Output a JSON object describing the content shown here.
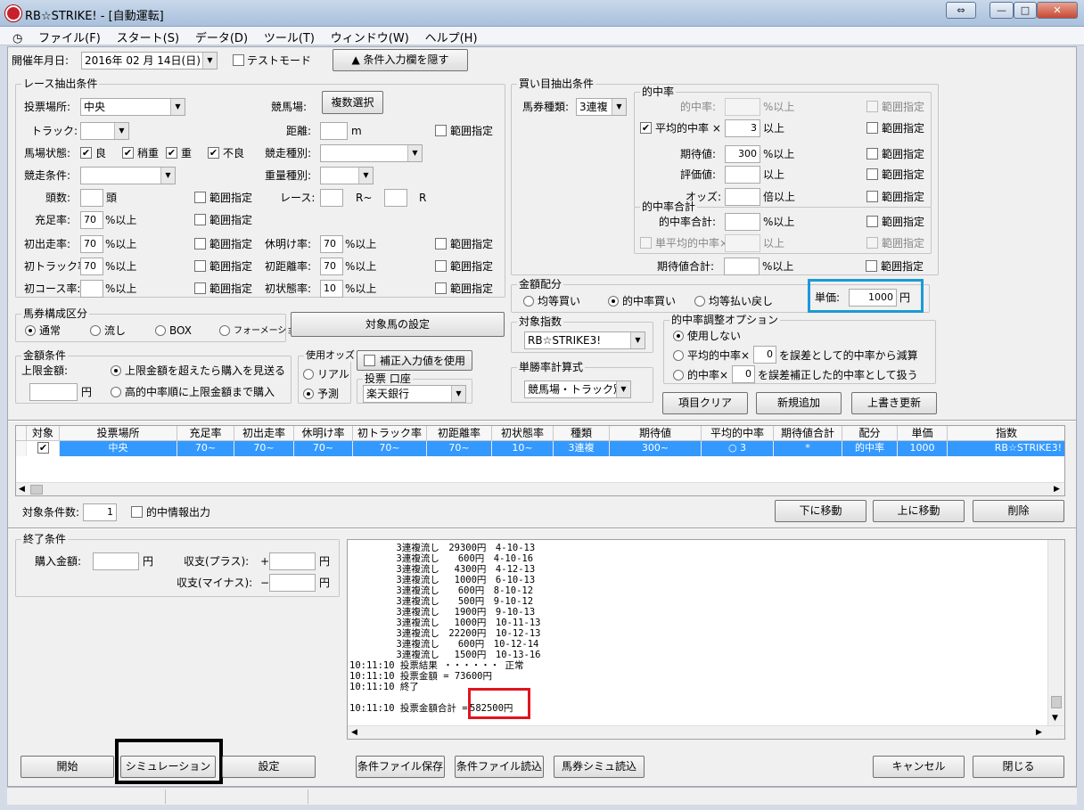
{
  "window": {
    "title": "RB☆STRIKE! - [自動運転]",
    "btn_restore": "⇔",
    "btn_min": "—",
    "btn_max": "□",
    "btn_close": "✕"
  },
  "menu": [
    "ファイル(F)",
    "スタート(S)",
    "データ(D)",
    "ツール(T)",
    "ウィンドウ(W)",
    "ヘルプ(H)"
  ],
  "mdi": [
    "_",
    "▭",
    "✕"
  ],
  "top": {
    "date_label": "開催年月日:",
    "date_value": "2016年 02 月 14日(日)",
    "test_mode": "テストモード",
    "hide_btn": "▲ 条件入力欄を隠す"
  },
  "race": {
    "legend": "レース抽出条件",
    "venue_label": "投票場所:",
    "venue_value": "中央",
    "course_label": "競馬場:",
    "multi_btn": "複数選択",
    "track_label": "トラック:",
    "dist_label": "距離:",
    "dist_unit": "m",
    "range": "範囲指定",
    "cond_label": "馬場状態:",
    "cond_opts": [
      "良",
      "稍重",
      "重",
      "不良"
    ],
    "kind_label": "競走種別:",
    "race_cond_label": "競走条件:",
    "weight_label": "重量種別:",
    "heads_label": "頭数:",
    "heads_unit": "頭",
    "race_label": "レース:",
    "race_r1": "R~",
    "race_r2": "R",
    "fill_label": "充足率:",
    "fill_value": "70",
    "pct_up": "%以上",
    "first_run_label": "初出走率:",
    "first_run_value": "70",
    "rest_label": "休明け率:",
    "rest_value": "70",
    "first_track_label": "初トラック率:",
    "first_track_value": "70",
    "first_dist_label": "初距離率:",
    "first_dist_value": "70",
    "first_course_label": "初コース率:",
    "first_cond_label": "初状態率:",
    "first_cond_value": "10"
  },
  "buy": {
    "legend": "買い目抽出条件",
    "ticket_label": "馬券種類:",
    "ticket_value": "3連複",
    "hit_legend": "的中率",
    "hit_label": "的中率:",
    "avg_hit_label": "平均的中率 ×",
    "avg_hit_value": "3",
    "up": "以上",
    "ev_label": "期待値:",
    "ev_value": "300",
    "score_label": "評価値:",
    "odds_label": "オッズ:",
    "odds_unit": "倍以上",
    "sum_legend": "的中率合計",
    "sum_label": "的中率合計:",
    "single_avg_label": "単平均的中率×",
    "ev_sum_label": "期待値合計:",
    "range": "範囲指定",
    "pct_up": "%以上"
  },
  "amount": {
    "legend": "金額配分",
    "opts": [
      "均等買い",
      "的中率買い",
      "均等払い戻し"
    ],
    "unit_label": "単価:",
    "unit_value": "1000",
    "yen": "円"
  },
  "bet_comp": {
    "legend": "馬券構成区分",
    "opts": [
      "通常",
      "流し",
      "BOX",
      "フォーメーション"
    ]
  },
  "target_btn": "対象馬の設定",
  "index": {
    "legend": "対象指数",
    "value": "RB☆STRIKE3!"
  },
  "win_calc": {
    "legend": "単勝率計算式",
    "value": "競馬場・トラック別"
  },
  "adjust": {
    "legend": "的中率調整オプション",
    "opt1": "使用しない",
    "opt2a": "平均的中率×",
    "opt2_val": "0",
    "opt2b": "を誤差として的中率から減算",
    "opt3a": "的中率×",
    "opt3_val": "0",
    "opt3b": "を誤差補正した的中率として扱う"
  },
  "money": {
    "legend": "金額条件",
    "cap_label": "上限金額:",
    "opt1": "上限金額を超えたら購入を見送る",
    "opt2": "高的中率順に上限金額まで購入",
    "yen": "円"
  },
  "odds_use": {
    "legend": "使用オッズ",
    "opt1": "リアル",
    "opt2": "予測"
  },
  "correction": "補正入力値を使用",
  "vote": {
    "legend": "投票 口座",
    "value": "楽天銀行"
  },
  "actions": {
    "clear": "項目クリア",
    "add": "新規追加",
    "overwrite": "上書き更新"
  },
  "grid": {
    "headers": [
      "対象",
      "投票場所",
      "充足率",
      "初出走率",
      "休明け率",
      "初トラック率",
      "初距離率",
      "初状態率",
      "種類",
      "期待値",
      "平均的中率",
      "期待値合計",
      "配分",
      "単価",
      "指数"
    ],
    "row": [
      "中央",
      "70~",
      "70~",
      "70~",
      "70~",
      "70~",
      "10~",
      "3連複",
      "300~",
      "○ 3",
      "*",
      "的中率",
      "1000",
      "RB☆STRIKE3!"
    ]
  },
  "cond_count": {
    "label": "対象条件数:",
    "value": "1",
    "hitinfo": "的中情報出力",
    "down": "下に移動",
    "up": "上に移動",
    "del": "削除"
  },
  "end": {
    "legend": "終了条件",
    "buy_label": "購入金額:",
    "plus_label": "収支(プラス):",
    "plus_sign": "+",
    "minus_label": "収支(マイナス):",
    "minus_sign": "−",
    "yen": "円"
  },
  "log": {
    "lines": [
      "　　　　　3連複流し　29300円　4-10-13",
      "　　　　　3連複流し　　600円　4-10-16",
      "　　　　　3連複流し　 4300円　4-12-13",
      "　　　　　3連複流し　 1000円　6-10-13",
      "　　　　　3連複流し　　600円　8-10-12",
      "　　　　　3連複流し　　500円　9-10-12",
      "　　　　　3連複流し　 1900円　9-10-13",
      "　　　　　3連複流し　 1000円　10-11-13",
      "　　　　　3連複流し　22200円　10-12-13",
      "　　　　　3連複流し　　600円　10-12-14",
      "　　　　　3連複流し　 1500円　10-13-16",
      "10:11:10 投票結果 ・・・・・・ 正常",
      "10:11:10 投票金額 = 73600円",
      "10:11:10 終了",
      "",
      "10:11:10 投票金額合計 ="
    ],
    "total": "582500円"
  },
  "bottom": {
    "start": "開始",
    "sim": "シミュレーション",
    "settings": "設定",
    "save": "条件ファイル保存",
    "load": "条件ファイル読込",
    "sim_load": "馬券シミュ読込",
    "cancel": "キャンセル",
    "close": "閉じる"
  }
}
